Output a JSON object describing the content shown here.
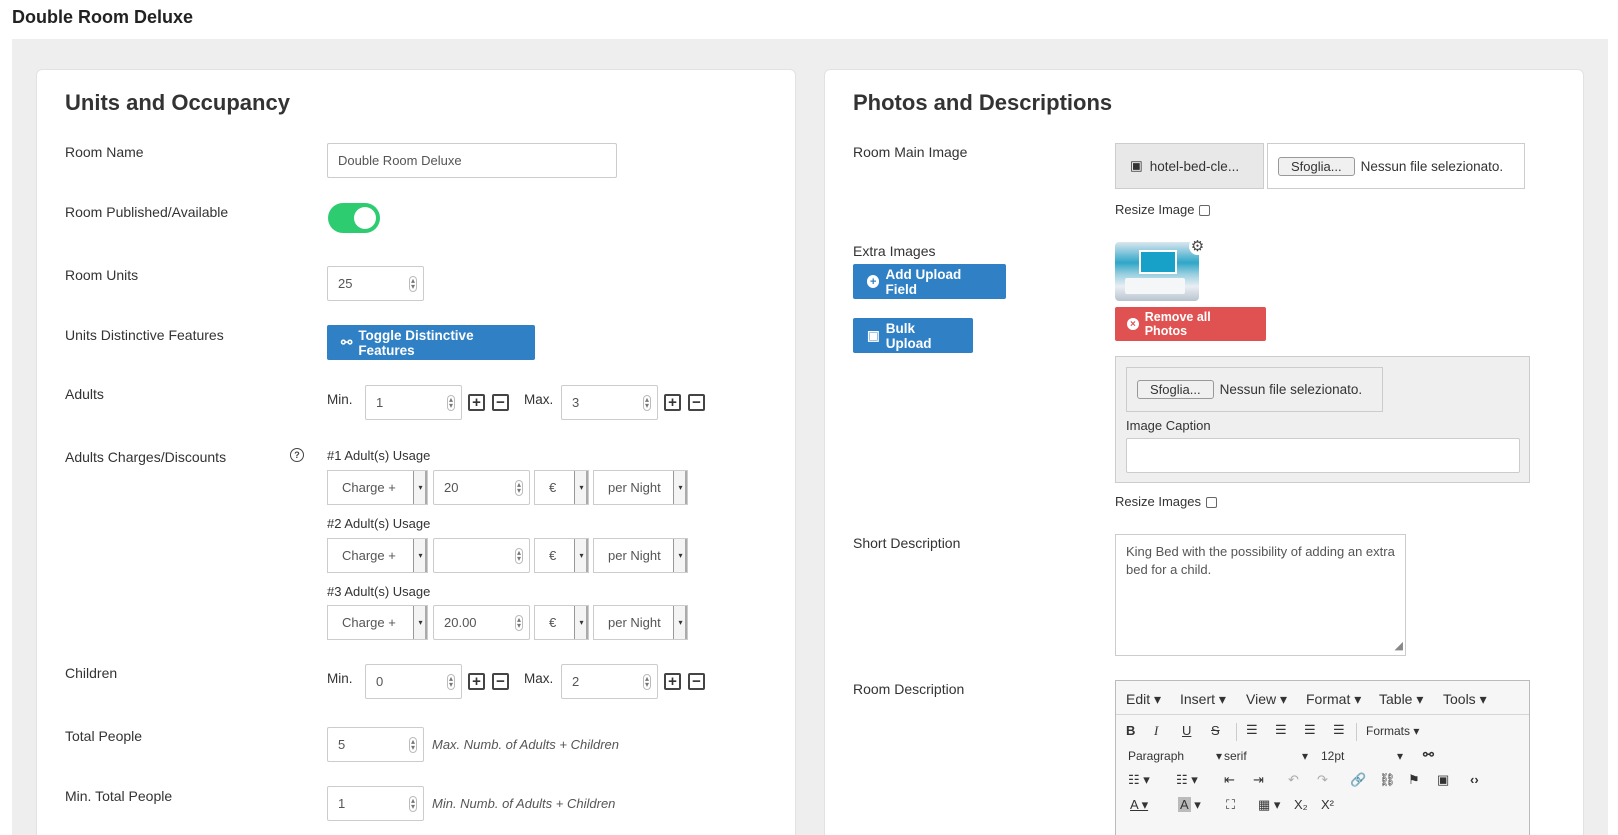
{
  "page": {
    "title": "Double Room Deluxe"
  },
  "left": {
    "title": "Units and Occupancy",
    "room_name": {
      "label": "Room Name",
      "value": "Double Room Deluxe"
    },
    "published": {
      "label": "Room Published/Available",
      "on": true
    },
    "units": {
      "label": "Room Units",
      "value": "25"
    },
    "features": {
      "label": "Units Distinctive Features",
      "button": "Toggle Distinctive Features"
    },
    "adults": {
      "label": "Adults",
      "min_label": "Min.",
      "min": "1",
      "max_label": "Max.",
      "max": "3"
    },
    "charges": {
      "label": "Adults Charges/Discounts",
      "rows": [
        {
          "usage": "#1 Adult(s) Usage",
          "op": "Charge +",
          "amount": "20",
          "currency": "€",
          "period": "per Night"
        },
        {
          "usage": "#2 Adult(s) Usage",
          "op": "Charge +",
          "amount": "",
          "currency": "€",
          "period": "per Night"
        },
        {
          "usage": "#3 Adult(s) Usage",
          "op": "Charge +",
          "amount": "20.00",
          "currency": "€",
          "period": "per Night"
        }
      ]
    },
    "children": {
      "label": "Children",
      "min_label": "Min.",
      "min": "0",
      "max_label": "Max.",
      "max": "2"
    },
    "total_people": {
      "label": "Total People",
      "value": "5",
      "note": "Max. Numb. of Adults + Children"
    },
    "min_total_people": {
      "label": "Min. Total People",
      "value": "1",
      "note": "Min. Numb. of Adults + Children"
    }
  },
  "right": {
    "title": "Photos and Descriptions",
    "main_image": {
      "label": "Room Main Image",
      "filename": "hotel-bed-cle...",
      "browse": "Sfoglia...",
      "no_file": "Nessun file selezionato.",
      "resize_label": "Resize Image"
    },
    "extra_images": {
      "label": "Extra Images",
      "add_button": "Add Upload Field",
      "bulk_button": "Bulk Upload",
      "remove_button": "Remove all Photos",
      "browse": "Sfoglia...",
      "no_file": "Nessun file selezionato.",
      "caption_label": "Image Caption",
      "resize_label": "Resize Images"
    },
    "short_description": {
      "label": "Short Description",
      "value": "King Bed with the possibility of adding an extra bed for a child."
    },
    "room_description": {
      "label": "Room Description",
      "menus": [
        "Edit",
        "Insert",
        "View",
        "Format",
        "Table",
        "Tools"
      ],
      "formats": "Formats",
      "block": "Paragraph",
      "font": "serif",
      "size": "12pt"
    }
  },
  "icons": {
    "spinner": "⇕",
    "caret": "▾",
    "plus": "+",
    "minus": "−",
    "help": "?",
    "binoculars": "⚯",
    "image": "▣",
    "gear": "⚙"
  }
}
